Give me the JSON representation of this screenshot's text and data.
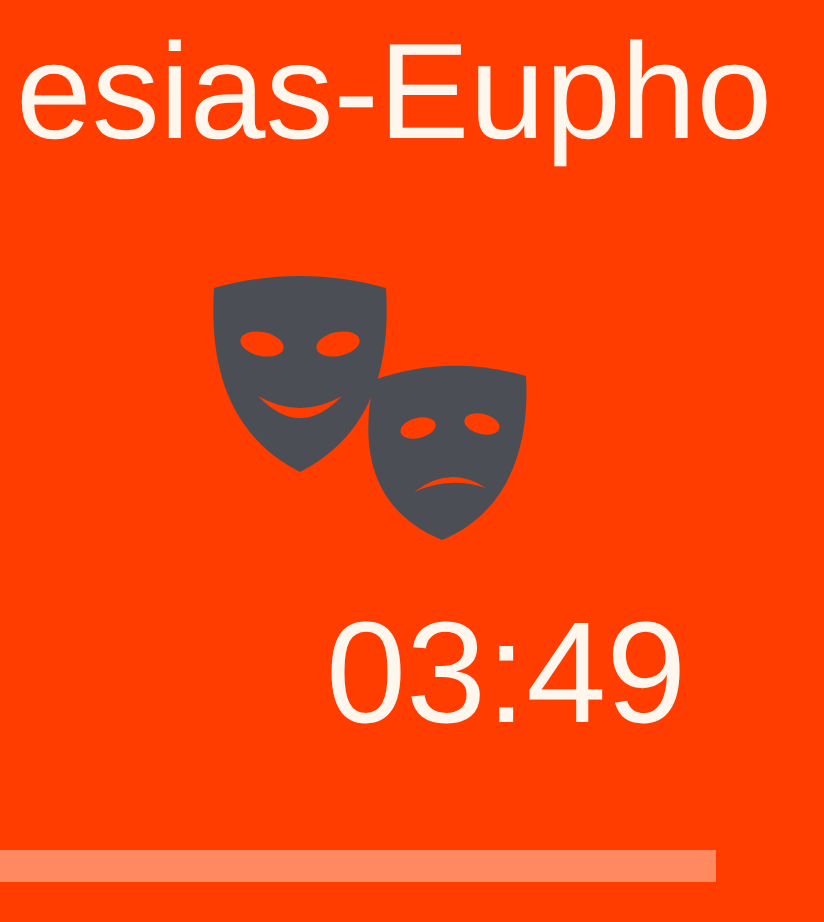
{
  "track": {
    "title": "esias-Eupho",
    "time": "03:49"
  }
}
